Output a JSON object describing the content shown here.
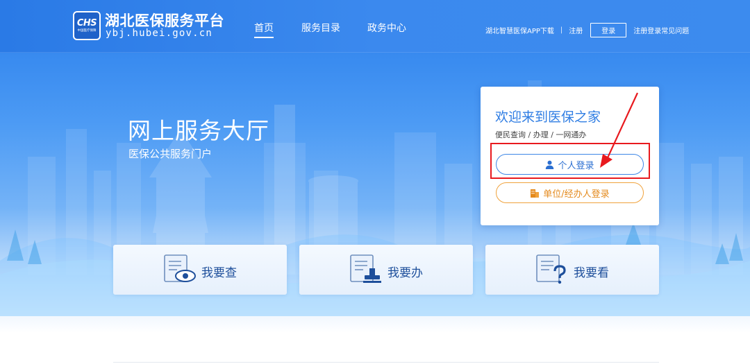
{
  "header": {
    "logo_mark": "CHS",
    "logo_sub": "中国医疗保障",
    "site_name": "湖北医保服务平台",
    "site_domain": "ybj.hubei.gov.cn",
    "nav": [
      {
        "label": "首页",
        "active": true
      },
      {
        "label": "服务目录",
        "active": false
      },
      {
        "label": "政务中心",
        "active": false
      }
    ],
    "top_links": {
      "app_download": "湖北智慧医保APP下载",
      "separator": "|",
      "register": "注册",
      "login": "登录",
      "faq": "注册登录常见问题"
    }
  },
  "hero": {
    "title": "网上服务大厅",
    "subtitle": "医保公共服务门户"
  },
  "login_card": {
    "title": "欢迎来到医保之家",
    "subtitle": "便民查询 / 办理 / 一网通办",
    "personal_login": "个人登录",
    "unit_login": "单位/经办人登录",
    "icons": {
      "personal": "user-icon",
      "unit": "building-icon"
    }
  },
  "services": [
    {
      "label": "我要查",
      "icon": "document-eye-icon"
    },
    {
      "label": "我要办",
      "icon": "document-stamp-icon"
    },
    {
      "label": "我要看",
      "icon": "document-question-icon"
    }
  ],
  "colors": {
    "primary_blue": "#2f7de3",
    "annotation_red": "#e8191e",
    "unit_orange": "#f0a23b"
  }
}
